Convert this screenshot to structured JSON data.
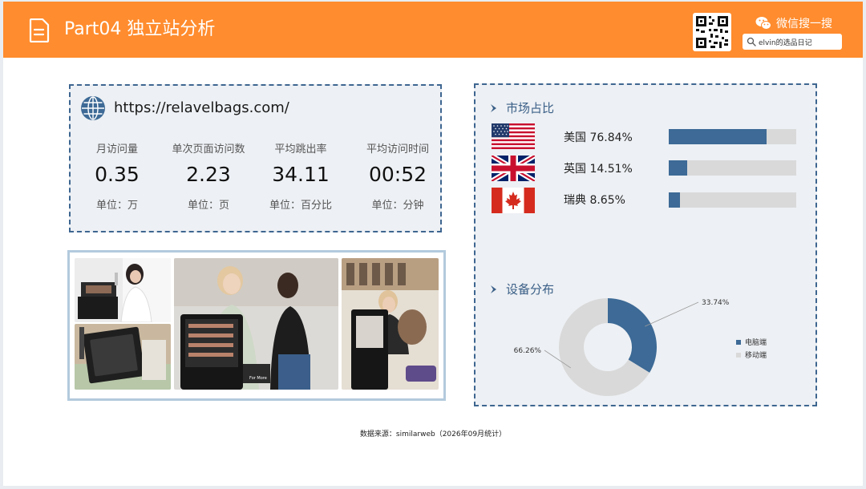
{
  "header": {
    "title": "Part04 独立站分析",
    "wechat_label": "微信搜一搜",
    "search_value": "elvin的选品日记"
  },
  "site": {
    "url": "https://relavelbags.com/",
    "metrics": [
      {
        "label": "月访问量",
        "value": "0.35",
        "unit": "单位：万"
      },
      {
        "label": "单次页面访问数",
        "value": "2.23",
        "unit": "单位：页"
      },
      {
        "label": "平均跳出率",
        "value": "34.11",
        "unit": "单位：百分比"
      },
      {
        "label": "平均访问时间",
        "value": "00:52",
        "unit": "单位：分钟"
      }
    ]
  },
  "market": {
    "title": "市场占比",
    "bar_color": "#3d6a96",
    "track_color": "#d9d9d9",
    "countries": [
      {
        "label": "美国 76.84%",
        "share": 76.84,
        "flag": "us-flag-icon"
      },
      {
        "label": "英国 14.51%",
        "share": 14.51,
        "flag": "uk-flag-icon"
      },
      {
        "label": "瑞典 8.65%",
        "share": 8.65,
        "flag": "canada-flag-icon"
      }
    ]
  },
  "device": {
    "title": "设备分布",
    "chart_data": {
      "type": "pie",
      "donut": true,
      "categories": [
        "电脑端",
        "移动端"
      ],
      "values": [
        33.74,
        66.26
      ],
      "labels": [
        "33.74%",
        "66.26%"
      ],
      "colors": [
        "#3d6a96",
        "#d9d9d9"
      ],
      "legend": "right"
    }
  },
  "footer": {
    "source": "数据来源：similarweb（2026年09月统计）"
  },
  "colors": {
    "header": "#ff8c2e",
    "accent": "#3d6a96",
    "card": "#edf0f4"
  }
}
